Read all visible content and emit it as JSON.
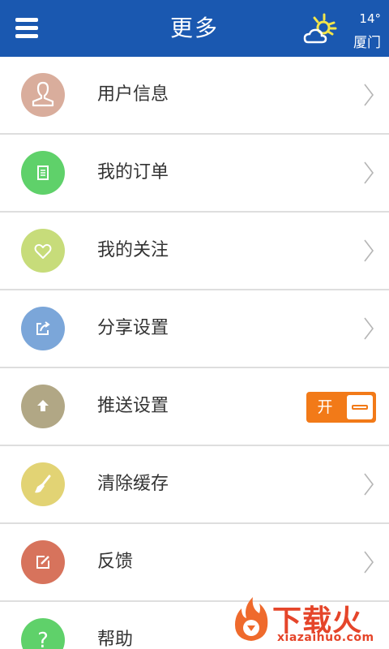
{
  "header": {
    "title": "更多",
    "menu_icon": "hamburger-icon",
    "weather": {
      "icon": "sun-cloud-icon",
      "temp": "14°",
      "city": "厦门"
    },
    "bg_color": "#1a58b0"
  },
  "menu_items": [
    {
      "label": "用户信息",
      "icon": "user-icon",
      "color": "#d9ad9c",
      "control": "chevron"
    },
    {
      "label": "我的订单",
      "icon": "document-icon",
      "color": "#5fd16a",
      "control": "chevron"
    },
    {
      "label": "我的关注",
      "icon": "heart-icon",
      "color": "#c7dc7a",
      "control": "chevron"
    },
    {
      "label": "分享设置",
      "icon": "share-icon",
      "color": "#7ba6d9",
      "control": "chevron"
    },
    {
      "label": "推送设置",
      "icon": "upload-arrow-icon",
      "color": "#b1a785",
      "control": "toggle"
    },
    {
      "label": "清除缓存",
      "icon": "brush-icon",
      "color": "#e2d374",
      "control": "chevron"
    },
    {
      "label": "反馈",
      "icon": "edit-icon",
      "color": "#d7735c",
      "control": "chevron"
    },
    {
      "label": "帮助",
      "icon": "help-icon",
      "color": "#5fd16a",
      "control": "chevron"
    }
  ],
  "push_toggle": {
    "on_label": "开",
    "state": "on",
    "color": "#f27a18"
  },
  "watermark": {
    "title": "下载火",
    "url": "xiazaihuo.com",
    "color": "#e5452a"
  }
}
